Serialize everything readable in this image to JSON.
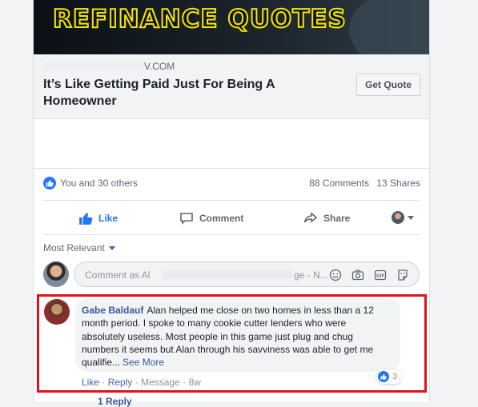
{
  "ad": {
    "banner_title": "REFINANCE QUOTES",
    "domain": "V.COM",
    "headline": "It’s Like Getting Paid Just For Being A Homeowner",
    "cta_label": "Get Quote"
  },
  "reactions": {
    "summary": "You and 30 others",
    "comments": "88 Comments",
    "shares": "13 Shares"
  },
  "actions": {
    "like": "Like",
    "comment": "Comment",
    "share": "Share"
  },
  "sort": {
    "label": "Most Relevant"
  },
  "composer": {
    "placeholder_start": "Comment as Al",
    "placeholder_end": "ge - N..."
  },
  "comment": {
    "author": "Gabe Baldauf",
    "text": "Alan helped me close on two homes in less than a 12 month period. I spoke to many cookie cutter lenders who were absolutely useless. Most people in this game just plug and chug numbers it seems but Alan through his savviness was able to get me qualifie...",
    "see_more": "See More",
    "reaction_count": "3",
    "like": "Like",
    "reply": "Reply",
    "message": "Message",
    "time": "8w",
    "separator": "·"
  },
  "replies_peek": "1 Reply",
  "colors": {
    "accent": "#2078f4",
    "link": "#385898",
    "highlight_border": "#e0111a",
    "banner_text": "#f3e600"
  }
}
